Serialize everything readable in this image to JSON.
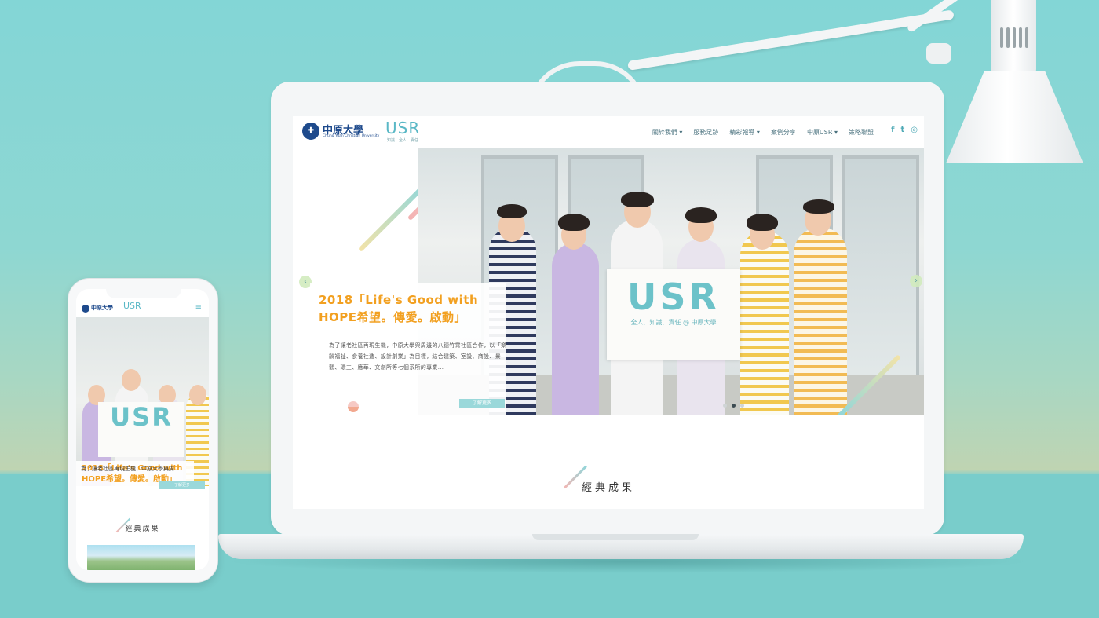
{
  "desktop": {
    "logo": {
      "school_cn": "中原大學",
      "school_en": "Chung Yuan Christian University",
      "usr": "USR",
      "usr_tagline": "知識．全人．責任"
    },
    "nav": [
      {
        "label": "關於我們 ▾"
      },
      {
        "label": "服務足跡"
      },
      {
        "label": "精彩報導 ▾"
      },
      {
        "label": "案例分享"
      },
      {
        "label": "中原USR ▾"
      },
      {
        "label": "策略聯盟"
      }
    ],
    "social": {
      "facebook": "f",
      "twitter": "t",
      "instagram": "◎"
    },
    "hero": {
      "title": "2018「Life's Good with HOPE希望。傳愛。啟動」",
      "body": "為了讓老社區再現生機，中原大學與周邊的八德竹霄社區合作，以「樂齡福祉、食養社造、設計創業」為目標，結合建築、室設、商設、景觀、環工、應華、文創所等七個系所的專業...",
      "button": "了解更多",
      "sign_text": "USR",
      "sign_sub": "全人．知識．責任 @ 中原大學",
      "prev_arrow": "‹",
      "next_arrow": "›",
      "slides": 3,
      "active_slide": 2
    },
    "section": {
      "title": "經典成果"
    }
  },
  "mobile": {
    "logo": {
      "school_cn": "中原大學",
      "usr": "USR"
    },
    "menu_icon": "≡",
    "hero": {
      "sign_text": "USR",
      "title": "2018「Life's Good with HOPE希望。傳愛。啟動」",
      "body": "為了讓老社區再現生機，中原大學與周...",
      "button": "了解更多"
    },
    "section": {
      "title": "經典成果"
    }
  },
  "colors": {
    "background": "#83d6d6",
    "accent_orange": "#f2a020",
    "accent_teal": "#5ab8c6",
    "brand_blue": "#1e4a8c"
  }
}
